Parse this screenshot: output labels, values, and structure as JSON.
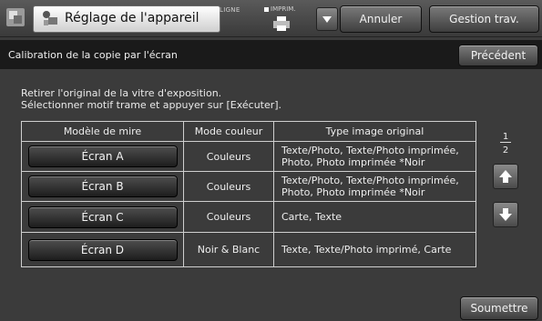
{
  "header": {
    "title": "Réglage de l'appareil",
    "ligne_label": "LIGNE",
    "imprim_label": "IMPRIM.",
    "annuler_label": "Annuler",
    "gestion_label": "Gestion trav."
  },
  "subheader": {
    "title": "Calibration de la copie par l'écran",
    "precedent_label": "Précédent"
  },
  "instructions": {
    "line1": "Retirer l'original de la vitre d'exposition.",
    "line2": "Sélectionner motif trame et appuyer sur [Exécuter]."
  },
  "table": {
    "headers": [
      "Modèle de mire",
      "Mode couleur",
      "Type image original"
    ],
    "rows": [
      {
        "button": "Écran A",
        "mode": "Couleurs",
        "type_line1": "Texte/Photo, Texte/Photo imprimée,",
        "type_line2": "Photo, Photo imprimée *Noir"
      },
      {
        "button": "Écran B",
        "mode": "Couleurs",
        "type_line1": "Texte/Photo, Texte/Photo imprimée,",
        "type_line2": "Photo, Photo imprimée *Noir"
      },
      {
        "button": "Écran C",
        "mode": "Couleurs",
        "type_line1": "Carte, Texte",
        "type_line2": ""
      },
      {
        "button": "Écran D",
        "mode": "Noir & Blanc",
        "type_line1": "Texte, Texte/Photo imprimé, Carte",
        "type_line2": ""
      }
    ]
  },
  "pagination": {
    "current": "1",
    "total": "2"
  },
  "footer": {
    "soumettre_label": "Soumettre"
  },
  "icons": {
    "app": "settings-app-icon",
    "title": "machine-settings-icon",
    "printer": "printer-icon",
    "dropdown": "triangle-down-icon",
    "up": "arrow-up-icon",
    "down": "arrow-down-icon"
  }
}
